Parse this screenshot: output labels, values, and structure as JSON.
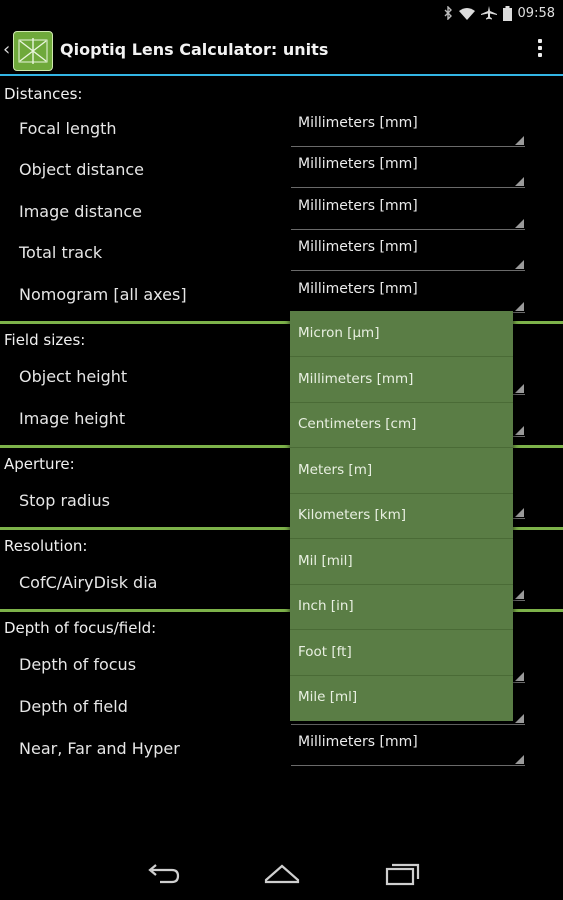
{
  "status": {
    "time": "09:58",
    "icons": [
      "bluetooth-icon",
      "wifi-icon",
      "airplane-icon",
      "battery-icon"
    ]
  },
  "header": {
    "title": "Qioptiq Lens Calculator: units",
    "app_icon": "lens-calculator-icon",
    "menu_icon": "overflow-menu-icon"
  },
  "sections": {
    "distances": "Distances:",
    "field_sizes": "Field sizes:",
    "aperture": "Aperture:",
    "resolution": "Resolution:",
    "depth": "Depth of focus/field:"
  },
  "rows": {
    "focal_length": {
      "label": "Focal length",
      "value": "Millimeters [mm]"
    },
    "object_distance": {
      "label": "Object distance",
      "value": "Millimeters [mm]"
    },
    "image_distance": {
      "label": "Image distance",
      "value": "Millimeters [mm]"
    },
    "total_track": {
      "label": "Total track",
      "value": "Millimeters [mm]"
    },
    "nomogram": {
      "label": "Nomogram [all axes]",
      "value": "Millimeters [mm]"
    },
    "object_height": {
      "label": "Object height"
    },
    "image_height": {
      "label": "Image height"
    },
    "stop_radius": {
      "label": "Stop radius"
    },
    "cofc": {
      "label": "CofC/AiryDisk dia"
    },
    "depth_of_focus": {
      "label": "Depth of focus"
    },
    "depth_of_field": {
      "label": "Depth of field"
    },
    "near_far_hyper": {
      "label": "Near, Far and Hyper",
      "value": "Millimeters [mm]"
    }
  },
  "dropdown": {
    "options": [
      "Micron [µm]",
      "Millimeters [mm]",
      "Centimeters [cm]",
      "Meters [m]",
      "Kilometers [km]",
      "Mil [mil]",
      "Inch [in]",
      "Foot [ft]",
      "Mile [ml]"
    ]
  },
  "colors": {
    "accent_blue": "#33b5e5",
    "divider_green": "#7db24a",
    "dropdown_bg": "#5a7d45"
  },
  "nav": {
    "icons": [
      "back-icon",
      "home-icon",
      "recent-apps-icon"
    ]
  }
}
